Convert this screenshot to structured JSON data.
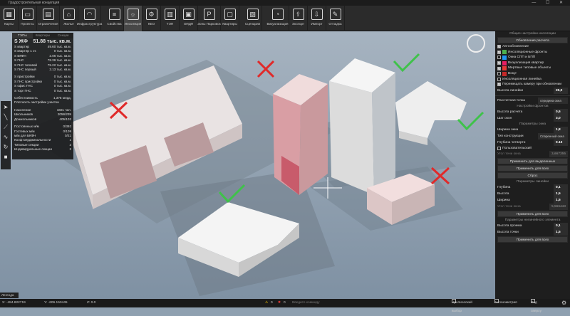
{
  "title": "Градостроительная концепция",
  "toolbar": [
    {
      "label": "Карты",
      "icon": "map-icon"
    },
    {
      "label": "Проекты",
      "icon": "folder-icon"
    },
    {
      "label": "Ограничения",
      "icon": "restriction-icon"
    },
    {
      "label": "Жилье",
      "icon": "house-icon"
    },
    {
      "label": "Инфраструктура",
      "icon": "infrastructure-icon"
    },
    {
      "label": "Свойства",
      "icon": "sliders-icon"
    },
    {
      "label": "Инсоляция",
      "icon": "sun-icon",
      "active": true
    },
    {
      "label": "КЕО",
      "icon": "gear-icon"
    },
    {
      "label": "ТЭП",
      "icon": "table-icon"
    },
    {
      "label": "ОИДП",
      "icon": "building-icon"
    },
    {
      "label": "Зоны Парковок",
      "icon": "parking-icon"
    },
    {
      "label": "Квартиры",
      "icon": "apartment-icon"
    },
    {
      "label": "Сценарии",
      "icon": "scenario-icon"
    },
    {
      "label": "Визуализация",
      "icon": "visualization-icon"
    },
    {
      "label": "Экспорт",
      "icon": "export-icon"
    },
    {
      "label": "Импорт",
      "icon": "import-icon"
    },
    {
      "label": "Отладка",
      "icon": "wrench-icon"
    }
  ],
  "left": {
    "tabs": [
      "ТЭПы",
      "Квартиры",
      "Секции"
    ],
    "sjf_label": "S ЖФ",
    "sjf_value": "51.88 тыс. кв.м.",
    "rows": [
      [
        "S квартир",
        "49.60 тыс. кв.м."
      ],
      [
        "S квартир 1 эт.",
        "0 тыс. кв.м."
      ],
      [
        "S БКФН",
        "2.06 тыс. кв.м."
      ],
      [
        "S ГНС",
        "78.36 тыс. кв.м."
      ],
      [
        "S ГНС типовой",
        "75.22 тыс. кв.м."
      ],
      [
        "S ГНС первый",
        "3.13 тыс. кв.м."
      ]
    ],
    "rows2": [
      [
        "S пристройки",
        "0 тыс. кв.м."
      ],
      [
        "S ГНС пристройки",
        "0 тыс. кв.м."
      ],
      [
        "S офис ГНС",
        "0 тыс. кв.м."
      ],
      [
        "S торг ГНС",
        "0 тыс. кв.м."
      ]
    ],
    "rows3": [
      [
        "Себестоимость",
        "1,375 млрд."
      ],
      [
        "Плотность застройки участка",
        ""
      ]
    ],
    "rows4": [
      [
        "Население",
        "1601 чел."
      ],
      [
        "Школьников",
        "2056/239"
      ],
      [
        "Дошкольников",
        "405/102"
      ]
    ],
    "rows5": [
      [
        "Постоянных м/м",
        "0/392"
      ],
      [
        "Гостевых м/м",
        "0/109"
      ],
      [
        "м/м для БКФН",
        "0/21"
      ],
      [
        "Коэф мерджинальности",
        "1"
      ],
      [
        "Типовые секции",
        "2"
      ],
      [
        "Индивидуальные секции",
        "2"
      ]
    ]
  },
  "left_tools": [
    "cursor-icon",
    "line-icon",
    "polyline-icon",
    "path-icon",
    "rotate-icon",
    "square-icon"
  ],
  "legend_label": "Легенда",
  "right": {
    "general_header": "Общие настройки инсоляции",
    "update_button": "Обновление расчета",
    "checks": [
      {
        "label": "Автообновление",
        "on": true
      },
      {
        "label": "Инсоляционные фронты",
        "on": true,
        "swatch": "#4caf50"
      },
      {
        "label": "Окна СПП и БПП",
        "on": false,
        "swatch": "#2196f3"
      },
      {
        "label": "Визуализация квартир",
        "on": true,
        "swatch": "#e91e63"
      },
      {
        "label": "Мертвые типовые объекты",
        "on": true,
        "swatch": "#e53935"
      },
      {
        "label": "Вокуг",
        "on": false,
        "swatch": "#c62828"
      },
      {
        "label": "Инсоляционная линейка",
        "on": false
      },
      {
        "label": "Перемещать камеру при обновлении",
        "on": true
      }
    ],
    "ruler_height_label": "Высота линейки",
    "ruler_height": "25,0",
    "calc_point_label": "Рассчетная точка",
    "calc_point": "середина окна",
    "window_header": "Настройки фронтов",
    "calc_height_label": "Высота расчета",
    "calc_height": "0,6",
    "window_step_label": "Шаг окон",
    "window_step": "3,0",
    "window_params_header": "Параметры окна",
    "window_width_label": "Ширина окна",
    "window_width": "1,8",
    "construction_label": "Тип конструкции",
    "construction": "Спаренный окна",
    "quarter_depth_label": "Глубина четверти",
    "quarter_depth": "0.13",
    "custom_label": "Пользовательский",
    "angle_label": "Угол тени окна",
    "angle": "3,667355",
    "apply_selected": "Применить для выделенных",
    "apply_all": "Применить для всех",
    "reset": "Сброс",
    "ruler_params_header": "Параметры линейки",
    "depth_label": "Глубина",
    "depth": "0,1",
    "height_label": "Высота",
    "height": "1,5",
    "width_label": "Ширина",
    "width": "1,5",
    "win_angle_label": "Угол тени окна",
    "win_angle": "5,566443",
    "apply_all2": "Применить для всех",
    "nonlin_header": "Параметры нелинейного элемента",
    "opening_height_label": "Высота проема",
    "opening_height": "0,1",
    "point_height_label": "Высота точки",
    "point_height": "1,5",
    "apply_all3": "Применить для всех"
  },
  "status": {
    "x": "X: -484.822719",
    "y": "Y: -606.153445",
    "z": "Z: 0.0",
    "warn_count": "0",
    "err_count": "0",
    "command_placeholder": "Введите команду",
    "cyclic": "Циклический выбор",
    "axonometry": "Аксонометрия",
    "top_view": "Вид сверху"
  }
}
